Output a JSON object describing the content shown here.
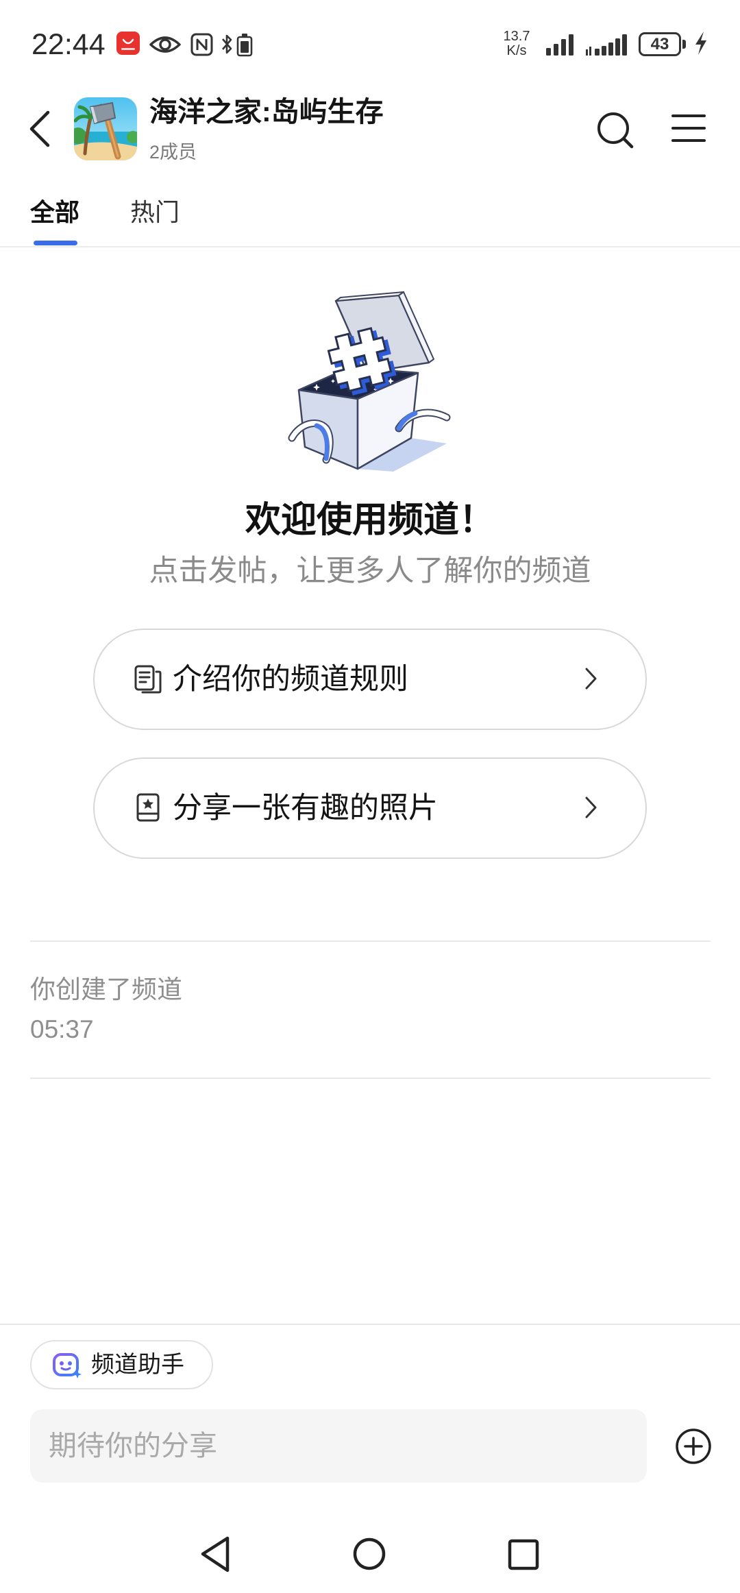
{
  "status_bar": {
    "time": "22:44",
    "net_speed_value": "13.7",
    "net_speed_unit": "K/s",
    "battery_level": "43",
    "left_icons": [
      "app-gallery-icon",
      "eye-icon",
      "nfc-icon",
      "bluetooth-battery-icon"
    ],
    "right_icons": [
      "signal-icon",
      "signal-icon",
      "battery-icon",
      "charging-icon"
    ]
  },
  "header": {
    "back_icon": "chevron-left-icon",
    "title": "海洋之家:岛屿生存",
    "members": "2成员",
    "search_icon": "search-icon",
    "menu_icon": "menu-icon"
  },
  "tabs": [
    {
      "label": "全部",
      "active": true
    },
    {
      "label": "热门",
      "active": false
    }
  ],
  "welcome": {
    "illustration": "open-box-hashtag-illustration",
    "title": "欢迎使用频道！",
    "subtitle": "点击发帖，让更多人了解你的频道"
  },
  "suggestions": [
    {
      "label": "介绍你的频道规则",
      "icon": "document-icon"
    },
    {
      "label": "分享一张有趣的照片",
      "icon": "photo-star-icon"
    }
  ],
  "activity": {
    "text": "你创建了频道",
    "time": "05:37"
  },
  "composer": {
    "assistant_label": "频道助手",
    "assistant_icon": "assistant-bot-icon",
    "placeholder": "期待你的分享",
    "add_icon": "plus-circle-icon"
  },
  "nav_bar": {
    "icons": [
      "nav-back-icon",
      "nav-home-icon",
      "nav-recents-icon"
    ]
  },
  "colors": {
    "accent": "#3a6ee8",
    "text_primary": "#111111",
    "text_secondary": "#8a8a8a",
    "input_background": "#f5f5f5",
    "border": "#d8d8d8"
  }
}
